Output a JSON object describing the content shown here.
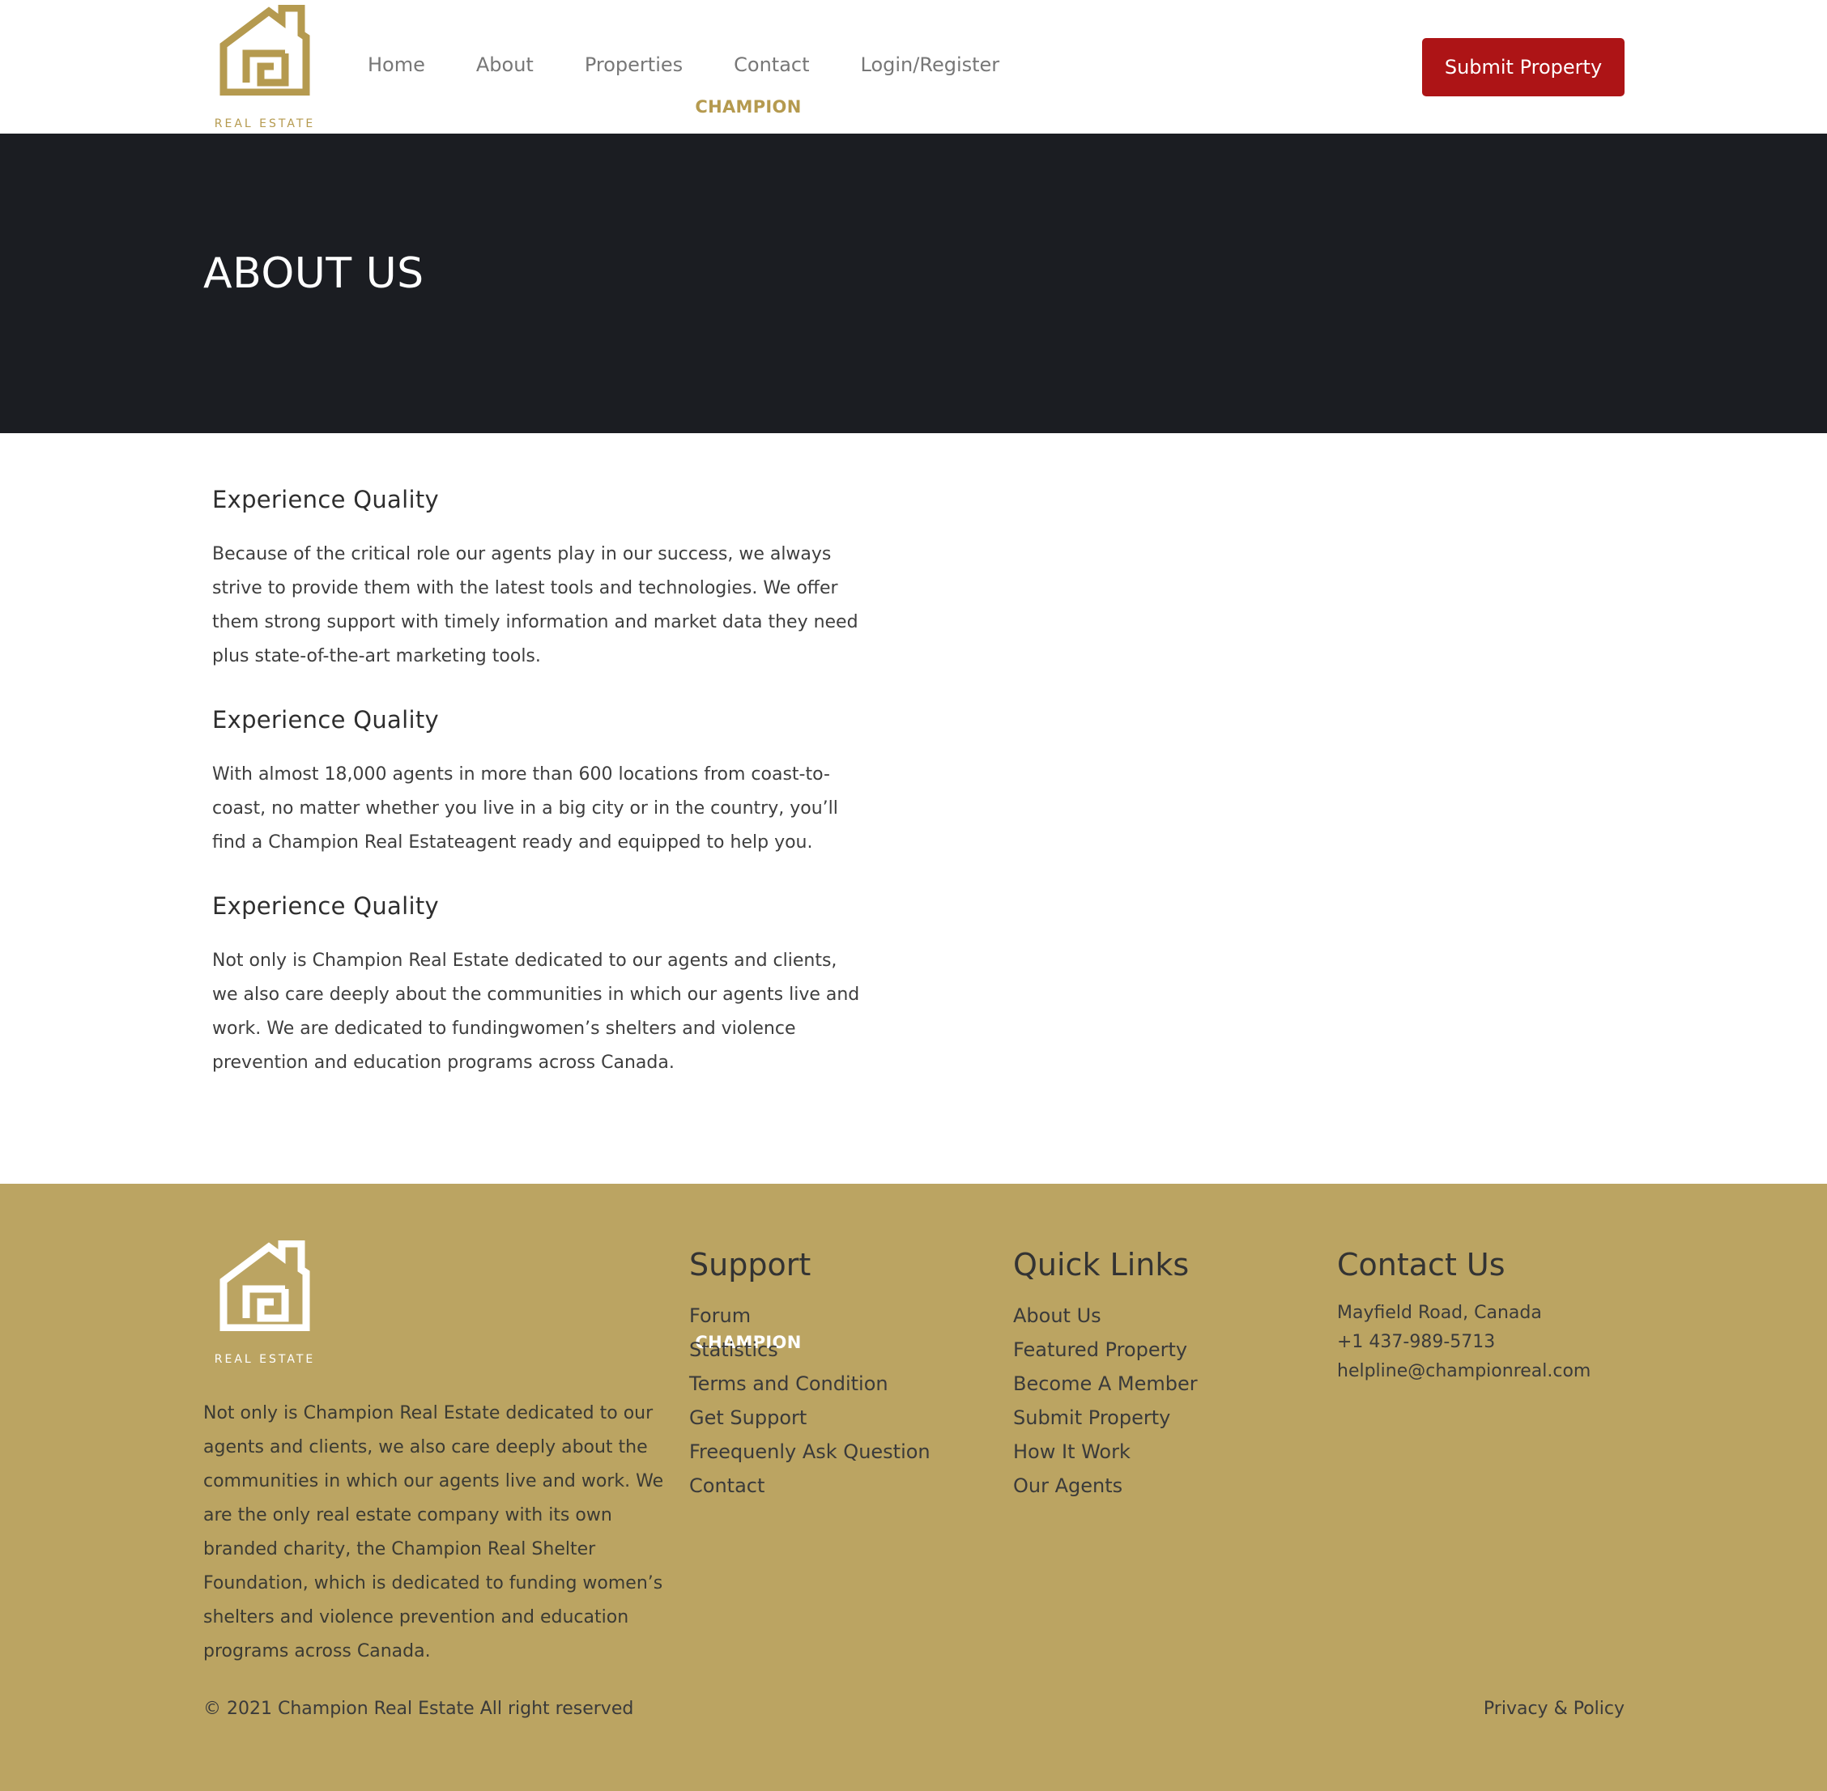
{
  "brand": {
    "name": "CHAMPION",
    "tagline": "REAL ESTATE",
    "logo_color": "#b59a4f"
  },
  "nav": {
    "items": [
      {
        "label": "Home"
      },
      {
        "label": "About"
      },
      {
        "label": "Properties"
      },
      {
        "label": "Contact"
      },
      {
        "label": "Login/Register"
      }
    ],
    "cta_label": "Submit Property",
    "cta_color": "#ad1416"
  },
  "hero": {
    "title": "ABOUT US",
    "bg_color": "#1b1d22"
  },
  "sections": [
    {
      "title": "Experience Quality",
      "text": "Because of the critical role our agents play in our success, we always strive to provide them with the latest tools and technologies. We offer them strong support with timely information and market data they need plus state-of-the-art marketing tools."
    },
    {
      "title": "Experience Quality",
      "text": "With almost 18,000 agents in more than 600 locations from coast-to-coast, no matter whether you live in a big city or in the country, you’ll find a Champion Real Estateagent ready and equipped to help you."
    },
    {
      "title": "Experience Quality",
      "text": "Not only is Champion Real Estate dedicated to our agents and clients, we also care deeply about the communities in which our agents live and work. We are dedicated to fundingwomen’s shelters and violence prevention and education programs across Canada."
    }
  ],
  "footer": {
    "bg_color": "#bba462",
    "about": "Not only is Champion Real Estate dedicated to our agents and clients, we also care deeply about the communities in which our agents live and work. We are the only real estate company with its own branded charity, the Champion Real Shelter Foundation, which is dedicated to funding women’s shelters and violence prevention and education programs across Canada.",
    "support": {
      "title": "Support",
      "items": [
        "Forum",
        "Statistics",
        "Terms and Condition",
        "Get Support",
        "Freequenly Ask Question",
        "Contact"
      ]
    },
    "quick_links": {
      "title": "Quick Links",
      "items": [
        "About Us",
        "Featured Property",
        "Become A Member",
        "Submit Property",
        "How It Work",
        "Our Agents"
      ]
    },
    "contact": {
      "title": "Contact Us",
      "address": "Mayfield Road, Canada",
      "phone": "+1 437-989-5713",
      "email": "helpline@championreal.com"
    },
    "copyright": "© 2021 Champion Real Estate All right reserved",
    "privacy": "Privacy & Policy"
  }
}
